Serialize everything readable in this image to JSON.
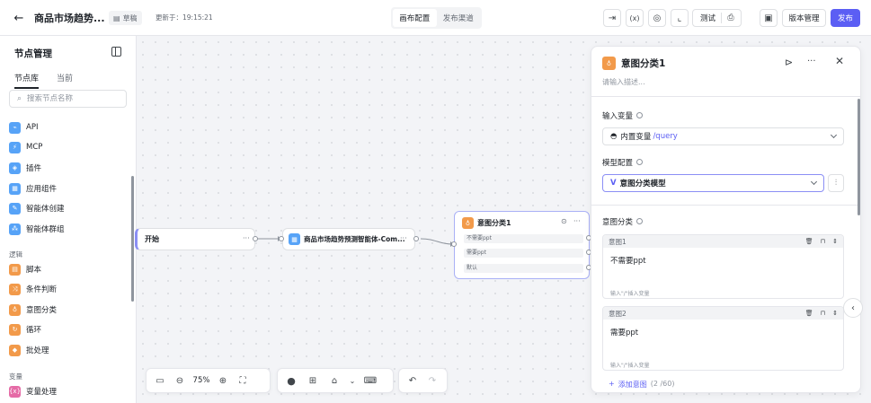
{
  "header": {
    "title": "商品市场趋势...",
    "draft_label": "草稿",
    "updated": "更新于：19:15:21",
    "tabs": [
      "画布配置",
      "发布渠道"
    ],
    "test_label": "测试",
    "version_label": "版本管理",
    "publish_label": "发布"
  },
  "sidebar": {
    "title": "节点管理",
    "tabs": [
      "节点库",
      "当前"
    ],
    "search_placeholder": "搜索节点名称",
    "items": [
      {
        "label": "API",
        "icon": "api-icon"
      },
      {
        "label": "MCP",
        "icon": "mcp-icon"
      },
      {
        "label": "插件",
        "icon": "plugin-icon"
      },
      {
        "label": "应用组件",
        "icon": "app-component-icon"
      },
      {
        "label": "智能体创建",
        "icon": "agent-create-icon"
      },
      {
        "label": "智能体群组",
        "icon": "agent-group-icon"
      }
    ],
    "logic_group": "逻辑",
    "logic_items": [
      {
        "label": "脚本",
        "icon": "script-icon"
      },
      {
        "label": "条件判断",
        "icon": "condition-icon"
      },
      {
        "label": "意图分类",
        "icon": "intent-icon"
      },
      {
        "label": "循环",
        "icon": "loop-icon"
      },
      {
        "label": "批处理",
        "icon": "batch-icon"
      }
    ],
    "variable_group": "变量",
    "variable_items": [
      {
        "label": "变量处理",
        "icon": "variable-icon"
      }
    ]
  },
  "canvas": {
    "start_node": "开始",
    "agent_node": "商品市场趋势预测智能体-Com...",
    "intent_node": {
      "title": "意图分类1",
      "rows": [
        "不需要ppt",
        "需要ppt",
        "默认"
      ]
    },
    "zoom": "75%"
  },
  "panel": {
    "title": "意图分类1",
    "desc_placeholder": "请输入描述...",
    "input_var_label": "输入变量",
    "input_var_prefix": "内置变量",
    "input_var_value": "/query",
    "model_label": "模型配置",
    "model_value": "意图分类模型",
    "intent_label": "意图分类",
    "intents": [
      {
        "name": "意图1",
        "text": "不需要ppt",
        "hint": "输入\"/\"插入变量"
      },
      {
        "name": "意图2",
        "text": "需要ppt",
        "hint": "输入\"/\"插入变量"
      }
    ],
    "add_intent": "添加意图",
    "add_count": "(2 /60)"
  }
}
